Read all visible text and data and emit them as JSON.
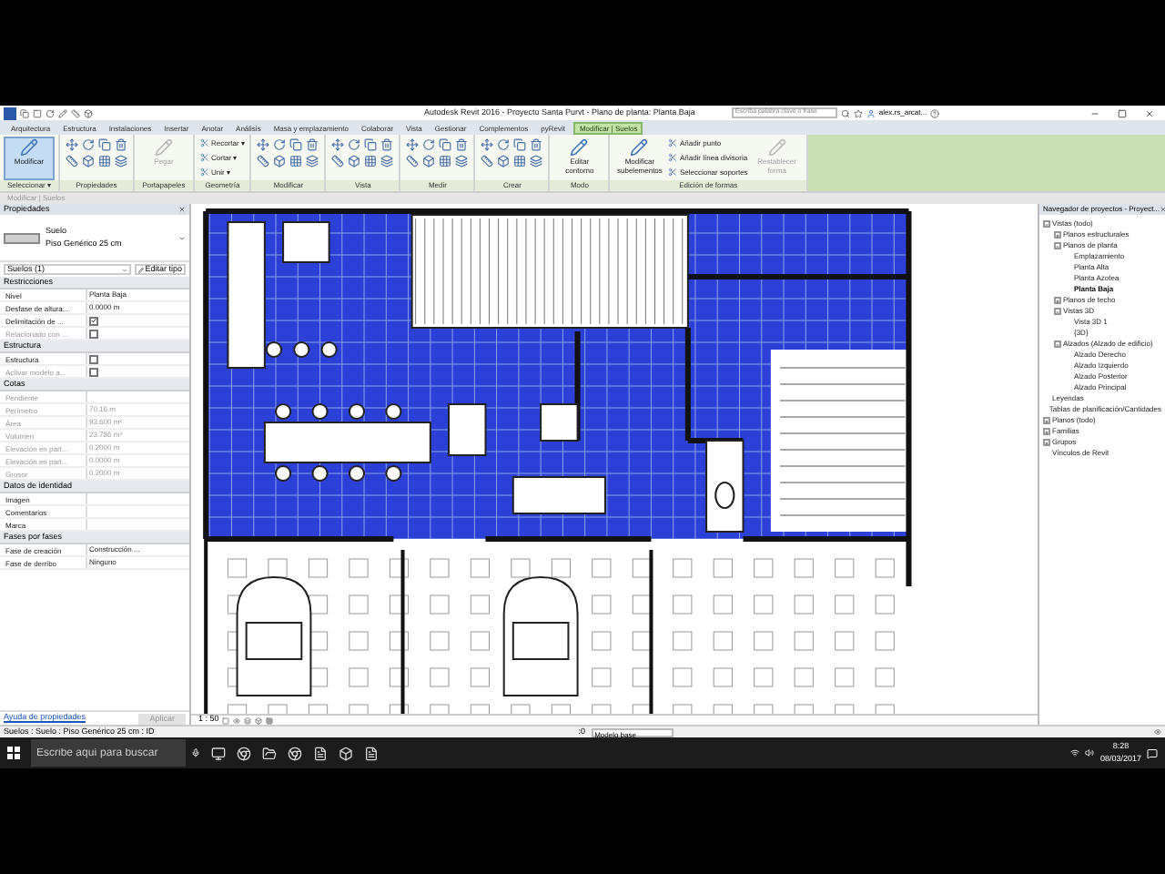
{
  "title_bar": {
    "title": "Autodesk Revit 2016 -   Proyecto Santa Purvt - Plano de planta: Planta Baja",
    "search": {
      "placeholder": "Escriba palabra clave o frase"
    },
    "user": "alex.rs_arcat..."
  },
  "tabs": [
    {
      "label": "Arquitectura",
      "selected": false
    },
    {
      "label": "Estructura",
      "selected": false
    },
    {
      "label": "Instalaciones",
      "selected": false
    },
    {
      "label": "Insertar",
      "selected": false
    },
    {
      "label": "Anotar",
      "selected": false
    },
    {
      "label": "Análisis",
      "selected": false
    },
    {
      "label": "Masa y emplazamiento",
      "selected": false
    },
    {
      "label": "Colaborar",
      "selected": false
    },
    {
      "label": "Vista",
      "selected": false
    },
    {
      "label": "Gestionar",
      "selected": false
    },
    {
      "label": "Complementos",
      "selected": false
    },
    {
      "label": "pyRevit",
      "selected": false
    },
    {
      "label": "Modificar | Suelos",
      "selected": true
    }
  ],
  "ribbon": [
    {
      "label": "Seleccionar ▾",
      "buttons": [
        {
          "label": "Modificar",
          "kind": "large",
          "selected": true,
          "disabled": false
        }
      ]
    },
    {
      "label": "Propiedades",
      "buttons": [
        {
          "kind": "icons"
        }
      ]
    },
    {
      "label": "Portapapeles",
      "buttons": [
        {
          "label": "Pegar",
          "kind": "large",
          "selected": false,
          "disabled": true
        }
      ]
    },
    {
      "label": "Geometría",
      "buttons": [
        {
          "label": "Recortar ▾",
          "kind": "small",
          "selected": false,
          "disabled": false
        },
        {
          "label": "Cortar ▾",
          "kind": "small",
          "selected": false,
          "disabled": false
        },
        {
          "label": "Unir ▾",
          "kind": "small",
          "selected": false,
          "disabled": false
        }
      ]
    },
    {
      "label": "Modificar",
      "buttons": [
        {
          "kind": "icons"
        }
      ]
    },
    {
      "label": "Vista",
      "buttons": [
        {
          "kind": "icons"
        }
      ]
    },
    {
      "label": "Medir",
      "buttons": [
        {
          "kind": "icons"
        }
      ]
    },
    {
      "label": "Crear",
      "buttons": [
        {
          "kind": "icons"
        }
      ]
    },
    {
      "label": "Modo",
      "buttons": [
        {
          "label": "Editar contorno",
          "kind": "large",
          "selected": false,
          "disabled": false
        }
      ]
    },
    {
      "label": "Edición de formas",
      "buttons": [
        {
          "label": "Modificar subelementos",
          "kind": "large",
          "selected": false,
          "disabled": false
        },
        {
          "label": "Añadir punto",
          "kind": "small",
          "selected": false,
          "disabled": false
        },
        {
          "label": "Añadir línea divisoria",
          "kind": "small",
          "selected": false,
          "disabled": false
        },
        {
          "label": "Seleccionar soportes",
          "kind": "small",
          "selected": false,
          "disabled": false
        },
        {
          "label": "Restablecer forma",
          "kind": "large",
          "selected": false,
          "disabled": true
        }
      ]
    }
  ],
  "options_bar": "Modificar | Suelos",
  "properties": {
    "title": "Propiedades",
    "type_family": "Suelo",
    "type_name": "Piso Genérico 25 cm",
    "selector": "Suelos (1)",
    "edit_type": "Editar tipo",
    "groups": [
      {
        "label": "Restricciones",
        "rows": [
          {
            "name": "Nivel",
            "value": "Planta Baja",
            "kind": "text",
            "disabled": false
          },
          {
            "name": "Desfase de altura...",
            "value": "0.0000 m",
            "kind": "text",
            "disabled": false
          },
          {
            "name": "Delimitación de ...",
            "checked": true,
            "kind": "check",
            "disabled": false
          },
          {
            "name": "Relacionado con ...",
            "checked": false,
            "kind": "check",
            "disabled": true
          }
        ]
      },
      {
        "label": "Estructura",
        "rows": [
          {
            "name": "Estructura",
            "checked": false,
            "kind": "check",
            "disabled": false
          },
          {
            "name": "Activar modelo a...",
            "checked": false,
            "kind": "check",
            "disabled": true
          }
        ]
      },
      {
        "label": "Cotas",
        "rows": [
          {
            "name": "Pendiente",
            "value": "",
            "kind": "text",
            "disabled": true
          },
          {
            "name": "Perímetro",
            "value": "70.16 m",
            "kind": "text",
            "disabled": true
          },
          {
            "name": "Área",
            "value": "93.600 m²",
            "kind": "text",
            "disabled": true
          },
          {
            "name": "Volumen",
            "value": "23.786 m³",
            "kind": "text",
            "disabled": true
          },
          {
            "name": "Elevación en part...",
            "value": "0.2000 m",
            "kind": "text",
            "disabled": true
          },
          {
            "name": "Elevación en part...",
            "value": "0.0000 m",
            "kind": "text",
            "disabled": true
          },
          {
            "name": "Grosor",
            "value": "0.2000 m",
            "kind": "text",
            "disabled": true
          }
        ]
      },
      {
        "label": "Datos de identidad",
        "rows": [
          {
            "name": "Imagen",
            "value": "",
            "kind": "text",
            "disabled": false
          },
          {
            "name": "Comentarios",
            "value": "",
            "kind": "text",
            "disabled": false
          },
          {
            "name": "Marca",
            "value": "",
            "kind": "text",
            "disabled": false
          }
        ]
      },
      {
        "label": "Fases por fases",
        "rows": [
          {
            "name": "Fase de creación",
            "value": "Construcción ...",
            "kind": "text",
            "disabled": false
          },
          {
            "name": "Fase de derribo",
            "value": "Ninguno",
            "kind": "text",
            "disabled": false
          }
        ]
      }
    ],
    "help_link": "Ayuda de propiedades",
    "apply": "Aplicar"
  },
  "browser": {
    "title": "Navegador de proyectos - Proyect...",
    "tree": [
      {
        "label": "Vistas (todo)",
        "expanded": true,
        "selected": false,
        "children": [
          {
            "label": "Planos estructurales",
            "expanded": false,
            "selected": false
          },
          {
            "label": "Planos de planta",
            "expanded": true,
            "selected": false,
            "children": [
              {
                "label": "Emplazamiento",
                "selected": false
              },
              {
                "label": "Planta Alta",
                "selected": false
              },
              {
                "label": "Planta Azotea",
                "selected": false
              },
              {
                "label": "Planta Baja",
                "selected": true
              }
            ]
          },
          {
            "label": "Planos de techo",
            "expanded": false,
            "selected": false
          },
          {
            "label": "Vistas 3D",
            "expanded": true,
            "selected": false,
            "children": [
              {
                "label": "Vista 3D 1",
                "selected": false
              },
              {
                "label": "{3D}",
                "selected": false
              }
            ]
          },
          {
            "label": "Alzados (Alzado de edificio)",
            "expanded": true,
            "selected": false,
            "children": [
              {
                "label": "Alzado Derecho",
                "selected": false
              },
              {
                "label": "Alzado Izquierdo",
                "selected": false
              },
              {
                "label": "Alzado Posterior",
                "selected": false
              },
              {
                "label": "Alzado Principal",
                "selected": false
              }
            ]
          }
        ]
      },
      {
        "label": "Leyendas",
        "selected": false
      },
      {
        "label": "Tablas de planificación/Cantidades",
        "selected": false
      },
      {
        "label": "Planos (todo)",
        "expanded": false,
        "selected": false
      },
      {
        "label": "Familias",
        "expanded": false,
        "selected": false
      },
      {
        "label": "Grupos",
        "expanded": false,
        "selected": false
      },
      {
        "label": "Vínculos de Revit",
        "selected": false
      }
    ]
  },
  "view_bar": {
    "scale": "1 : 50"
  },
  "status_bar": {
    "text": "Suelos : Suelo : Piso Genérico 25 cm : ID",
    "count": ":0",
    "model": "Modelo base"
  },
  "taskbar": {
    "search": {
      "placeholder": "Escribe aquí para buscar"
    },
    "time": "8:28",
    "date": "08/03/2017"
  }
}
